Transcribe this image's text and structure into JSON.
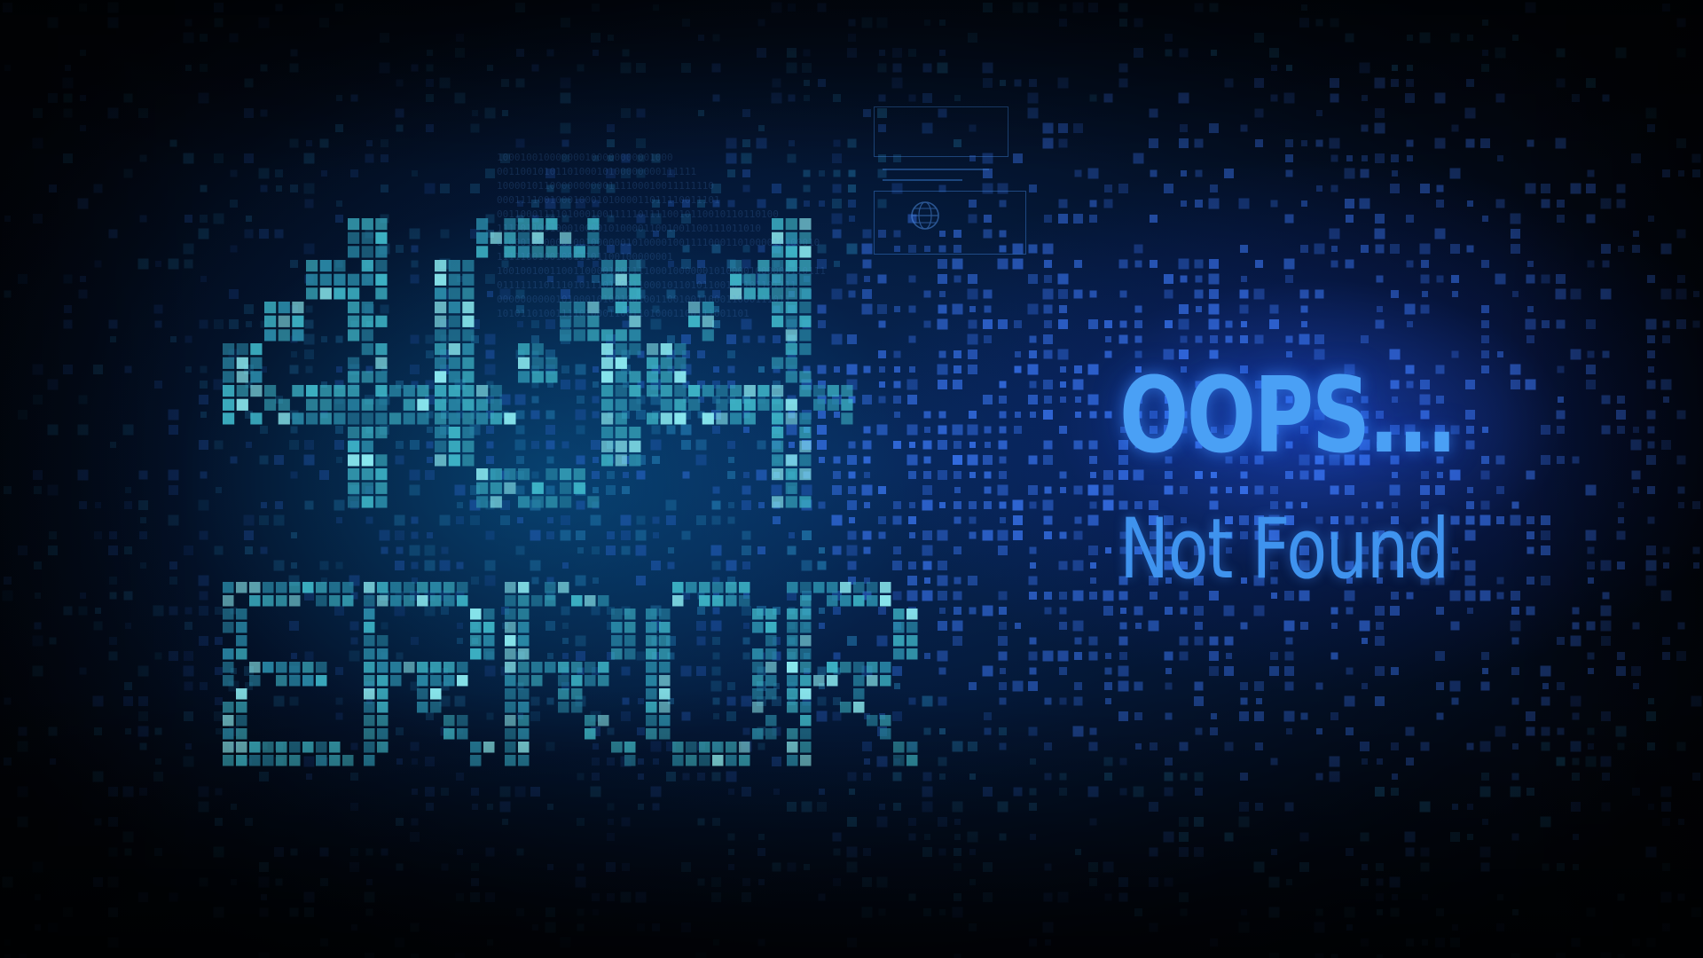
{
  "error_code": "404",
  "error_word": "ERROR",
  "heading": "OOPS...",
  "subheading": "Not Found",
  "colors": {
    "background": "#02060f",
    "glyph_teal": "#3fb7c9",
    "glyph_teal_bright": "#7fe0ea",
    "matrix_blue": "#2f6fe0",
    "heading_blue": "#4aa0f5"
  },
  "icons": {
    "panel_icon": "globe-icon"
  }
}
